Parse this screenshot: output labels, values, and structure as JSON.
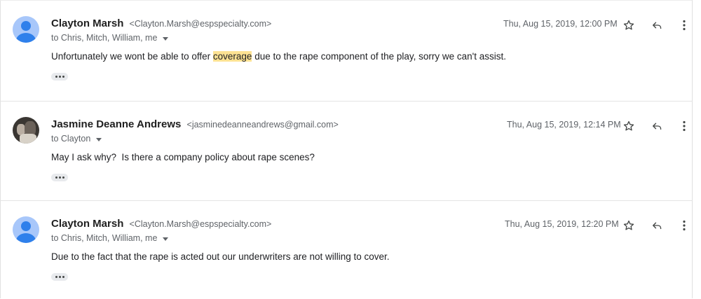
{
  "messages": [
    {
      "sender_name": "Clayton Marsh",
      "sender_email": "<Clayton.Marsh@espspecialty.com>",
      "recipients": "to Chris, Mitch, William, me",
      "date": "Thu, Aug 15, 2019, 12:00 PM",
      "body_before": "Unfortunately we wont be able to offer ",
      "body_highlight": "coverage",
      "body_after": " due to the rape component of the play, sorry we can't assist.",
      "avatar": "default-person-icon"
    },
    {
      "sender_name": "Jasmine Deanne Andrews",
      "sender_email": "<jasminedeanneandrews@gmail.com>",
      "recipients": "to Clayton",
      "date": "Thu, Aug 15, 2019, 12:14 PM",
      "body": "May I ask why?  Is there a company policy about rape scenes?",
      "avatar": "photo"
    },
    {
      "sender_name": "Clayton Marsh",
      "sender_email": "<Clayton.Marsh@espspecialty.com>",
      "recipients": "to Chris, Mitch, William, me",
      "date": "Thu, Aug 15, 2019, 12:20 PM",
      "body": "Due to the fact that the rape is acted out our underwriters are not willing to cover.",
      "avatar": "default-person-icon"
    }
  ],
  "icons": {
    "star": "star-icon",
    "reply": "reply-icon",
    "more": "more-vert-icon",
    "expand": "show-trimmed-content-icon"
  },
  "colors": {
    "highlight": "#fde293",
    "avatar_bg": "#a8c7fa",
    "avatar_fg": "#1a73e8"
  }
}
